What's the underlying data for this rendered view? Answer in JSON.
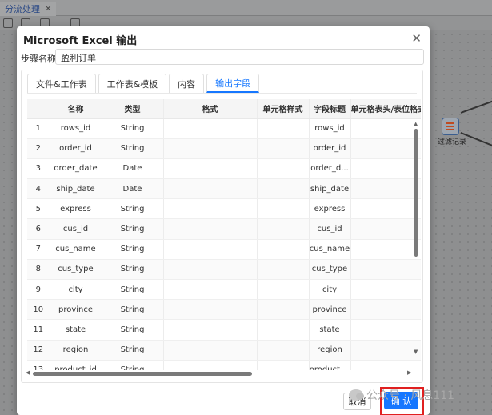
{
  "background": {
    "tab_title": "分流处理",
    "tab_close": "✕",
    "node_label": "过滤记录"
  },
  "dialog": {
    "title": "Microsoft Excel 输出",
    "close": "✕",
    "step_name_label": "步骤名称:",
    "step_name_value": "盈利订单",
    "tabs": [
      {
        "label": "文件&工作表",
        "active": false
      },
      {
        "label": "工作表&模板",
        "active": false
      },
      {
        "label": "内容",
        "active": false
      },
      {
        "label": "输出字段",
        "active": true
      }
    ],
    "table": {
      "headers": [
        "",
        "名称",
        "类型",
        "格式",
        "单元格样式",
        "字段标题",
        "单元格表头/表位格式"
      ],
      "rows": [
        [
          "1",
          "rows_id",
          "String",
          "",
          "",
          "rows_id",
          ""
        ],
        [
          "2",
          "order_id",
          "String",
          "",
          "",
          "order_id",
          ""
        ],
        [
          "3",
          "order_date",
          "Date",
          "",
          "",
          "order_d...",
          ""
        ],
        [
          "4",
          "ship_date",
          "Date",
          "",
          "",
          "ship_date",
          ""
        ],
        [
          "5",
          "express",
          "String",
          "",
          "",
          "express",
          ""
        ],
        [
          "6",
          "cus_id",
          "String",
          "",
          "",
          "cus_id",
          ""
        ],
        [
          "7",
          "cus_name",
          "String",
          "",
          "",
          "cus_name",
          ""
        ],
        [
          "8",
          "cus_type",
          "String",
          "",
          "",
          "cus_type",
          ""
        ],
        [
          "9",
          "city",
          "String",
          "",
          "",
          "city",
          ""
        ],
        [
          "10",
          "province",
          "String",
          "",
          "",
          "province",
          ""
        ],
        [
          "11",
          "state",
          "String",
          "",
          "",
          "state",
          ""
        ],
        [
          "12",
          "region",
          "String",
          "",
          "",
          "region",
          ""
        ],
        [
          "13",
          "product_id",
          "String",
          "",
          "",
          "product_id",
          ""
        ]
      ]
    },
    "buttons": {
      "cancel": "取消",
      "ok": "确 认"
    }
  },
  "watermark": "公众号 · 风息111",
  "colors": {
    "accent": "#1677ff",
    "highlight": "#e02020"
  }
}
